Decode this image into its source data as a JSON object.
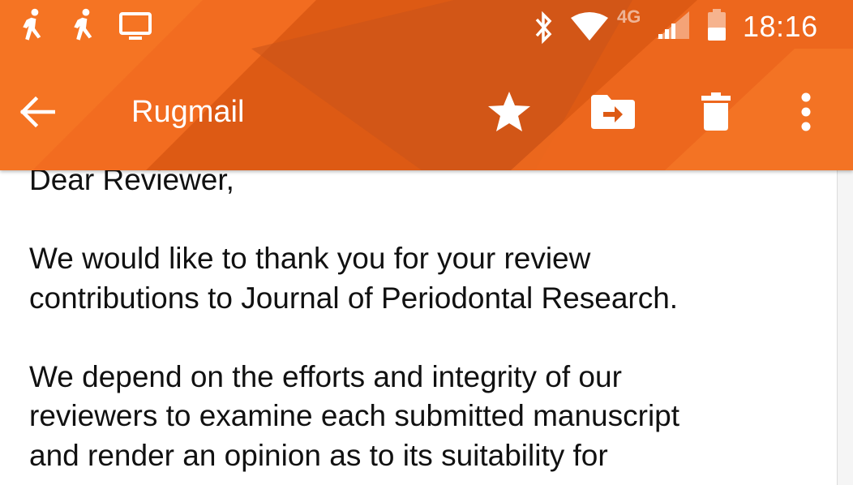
{
  "status_bar": {
    "time": "18:16",
    "network_label": "4G",
    "icons": [
      "walking-icon",
      "walking-icon",
      "screen-cast-icon",
      "bluetooth-icon",
      "wifi-icon",
      "cell-signal-icon",
      "battery-icon"
    ]
  },
  "toolbar": {
    "title": "Rugmail",
    "icons": [
      "back-arrow-icon",
      "star-icon",
      "move-to-folder-icon",
      "delete-icon",
      "more-vert-icon"
    ]
  },
  "email": {
    "greeting": "Dear Reviewer,",
    "paragraph1_lines": [
      "We would like to thank you for your review",
      "contributions to Journal of Periodontal Research."
    ],
    "paragraph2_lines": [
      "We depend on the efforts and integrity of our",
      "reviewers to examine each submitted manuscript",
      "and render an opinion as to its suitability for"
    ]
  },
  "colors": {
    "header_base": "#dd5a14",
    "header_light": "#f46e22",
    "header_dark": "#c44f12",
    "text": "#111111",
    "icon": "#ffffff"
  }
}
